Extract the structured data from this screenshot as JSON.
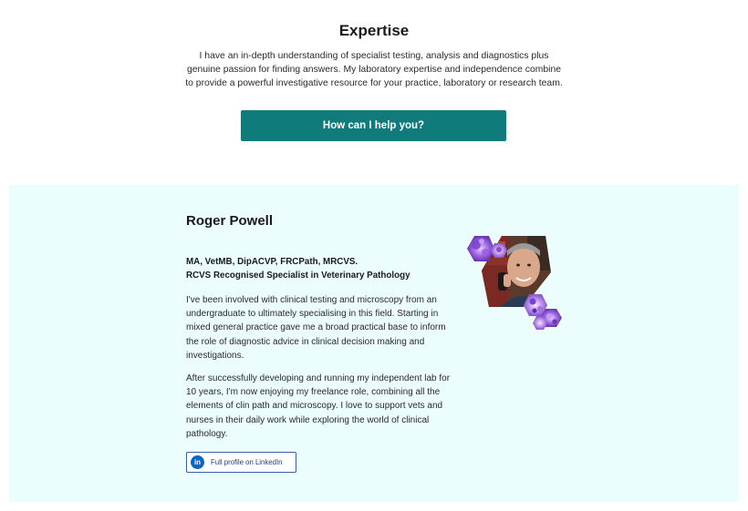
{
  "expertise": {
    "title": "Expertise",
    "description": "I have an in-depth understanding of specialist testing, analysis and diagnostics plus genuine passion for finding answers. My laboratory expertise and independence combine to provide a powerful investigative resource for your practice, laboratory or research team.",
    "cta_label": "How can I help you?",
    "cta_color": "#0f7b7b"
  },
  "profile": {
    "name": "Roger Powell",
    "credentials_line1": "MA, VetMB, DipACVP, FRCPath, MRCVS.",
    "credentials_line2": "RCVS Recognised Specialist in Veterinary Pathology",
    "bio_paragraph1": "I've been involved with clinical testing and microscopy from an undergraduate to ultimately specialising in this field. Starting in mixed general practice gave me a broad practical base to inform the role of diagnostic advice in clinical decision making and investigations.",
    "bio_paragraph2": "After successfully developing and running my independent lab for 10 years, I'm now enjoying my freelance role, combining all the elements of clin path and microscopy. I love to support vets and nurses in their daily work while exploring the world of clinical pathology.",
    "linkedin_label": "Full profile on LinkedIn",
    "linkedin_icon": "linkedin-icon",
    "background_color": "#ecfdfd"
  }
}
